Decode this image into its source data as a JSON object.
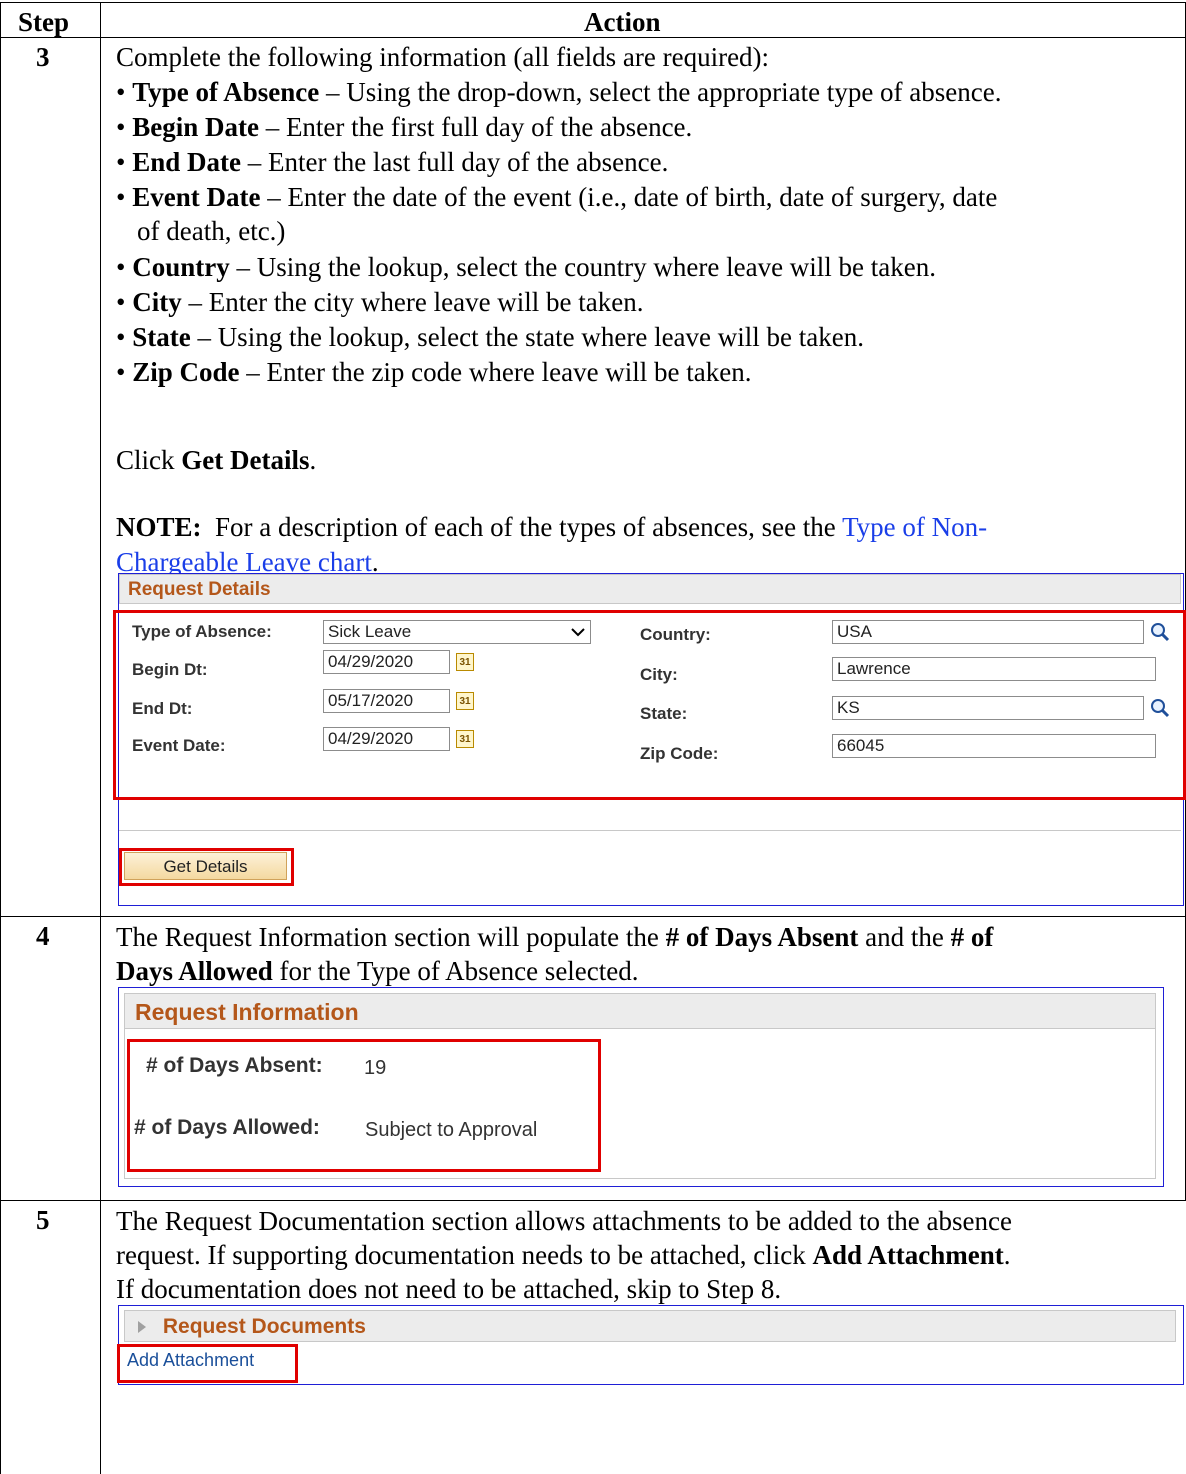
{
  "table": {
    "col_step": "Step",
    "col_action": "Action"
  },
  "step3": {
    "num": "3",
    "intro": "Complete the following information (all fields are required):",
    "bullets": [
      {
        "term": "Type of Absence",
        "desc": " – Using the drop-down, select the appropriate type of absence."
      },
      {
        "term": "Begin Date",
        "desc": " – Enter the first full day of the absence."
      },
      {
        "term": "End Date",
        "desc": " – Enter the last full day of the absence."
      },
      {
        "term": "Event Date",
        "desc": " – Enter the date of the event (i.e., date of birth, date of surgery, date",
        "desc2": "of death, etc.)"
      },
      {
        "term": "Country",
        "desc": " – Using the lookup, select the country where leave will be taken."
      },
      {
        "term": "City",
        "desc": " – Enter the city where leave will be taken."
      },
      {
        "term": "State",
        "desc": " – Using the lookup, select the state where leave will be taken."
      },
      {
        "term": "Zip Code",
        "desc": " – Enter the zip code where leave will be taken."
      }
    ],
    "click_pre": "Click ",
    "click_bold": "Get Details",
    "click_post": ".",
    "note_bold": "NOTE:",
    "note_text": "  For a description of each of the types of absences, see the ",
    "note_link1": "Type of Non-",
    "note_link2": "Chargeable Leave chart",
    "note_end": ".",
    "panel": {
      "title": "Request Details",
      "type_label": "Type of Absence:",
      "type_value": "Sick Leave",
      "begin_label": "Begin Dt:",
      "begin_value": "04/29/2020",
      "end_label": "End Dt:",
      "end_value": "05/17/2020",
      "event_label": "Event Date:",
      "event_value": "04/29/2020",
      "country_label": "Country:",
      "country_value": "USA",
      "city_label": "City:",
      "city_value": "Lawrence",
      "state_label": "State:",
      "state_value": "KS",
      "zip_label": "Zip Code:",
      "zip_value": "66045",
      "button": "Get Details",
      "cal_glyph": "31"
    }
  },
  "step4": {
    "num": "4",
    "line1_pre": "The Request Information section will populate the ",
    "line1_b1": "# of Days Absent",
    "line1_mid": " and the ",
    "line1_b2": "# of",
    "line2_b": "Days Allowed",
    "line2_post": " for the Type of Absence selected.",
    "panel": {
      "title": "Request Information",
      "absent_label": "# of Days Absent:",
      "absent_value": "19",
      "allowed_label": "# of Days Allowed:",
      "allowed_value": "Subject to Approval"
    }
  },
  "step5": {
    "num": "5",
    "line1": "The Request Documentation section allows attachments to be added to the absence",
    "line2_pre": "request. If supporting documentation needs to be attached, click ",
    "line2_b": "Add Attachment",
    "line2_post": ".",
    "line3": "If documentation does not need to be attached, skip to Step 8.",
    "panel": {
      "title": "Request Documents",
      "link": "Add Attachment"
    }
  }
}
